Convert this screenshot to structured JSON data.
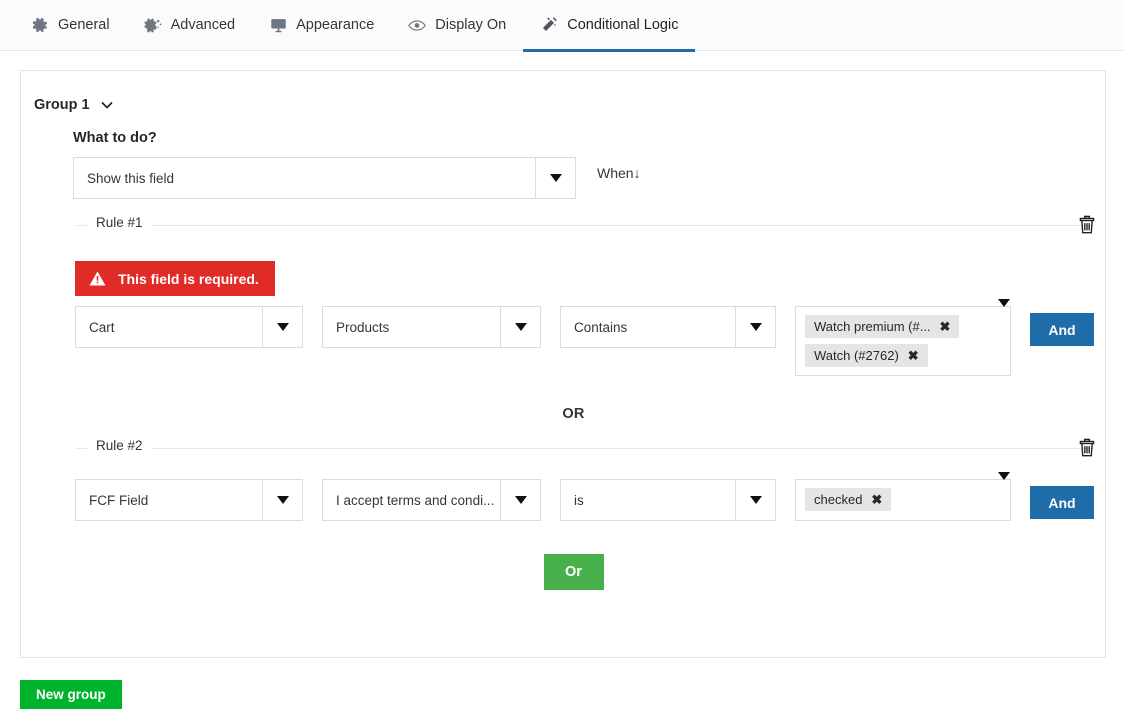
{
  "tabs": [
    {
      "label": "General",
      "icon": "gear-icon",
      "active": false
    },
    {
      "label": "Advanced",
      "icon": "gears-icon",
      "active": false
    },
    {
      "label": "Appearance",
      "icon": "monitor-icon",
      "active": false
    },
    {
      "label": "Display On",
      "icon": "eye-icon",
      "active": false
    },
    {
      "label": "Conditional Logic",
      "icon": "magic-wand-icon",
      "active": true
    }
  ],
  "group": {
    "title": "Group 1",
    "collapse_icon": "chevron-down-icon",
    "what_to_do_label": "What to do?",
    "action_value": "Show this field",
    "when_label": "When↓"
  },
  "rules": [
    {
      "legend": "Rule #1",
      "delete_icon": "trash-icon",
      "error": {
        "icon": "warning-icon",
        "text": "This field is required."
      },
      "field_value": "Cart",
      "subfield_value": "Products",
      "operator_value": "Contains",
      "tags": [
        {
          "label": "Watch premium (#...",
          "remove_icon": "close-icon"
        },
        {
          "label": "Watch (#2762)",
          "remove_icon": "close-icon"
        }
      ],
      "and_label": "And"
    },
    {
      "legend": "Rule #2",
      "delete_icon": "trash-icon",
      "field_value": "FCF Field",
      "subfield_value": "I accept terms and condi...",
      "operator_value": "is",
      "tags": [
        {
          "label": "checked",
          "remove_icon": "close-icon"
        }
      ],
      "and_label": "And"
    }
  ],
  "or_divider_label": "OR",
  "or_button_label": "Or",
  "new_group_label": "New group",
  "colors": {
    "accent_blue": "#1e6ca8",
    "error_red": "#e02b27",
    "or_green": "#48b04b",
    "new_group_green": "#00b32c",
    "border_gray": "#dcdcdc"
  }
}
